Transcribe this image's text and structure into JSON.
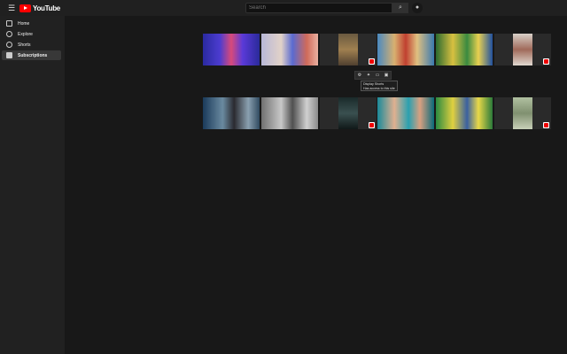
{
  "header": {
    "logo_text": "YouTube",
    "search_placeholder": "Search",
    "menu_icon": "hamburger-icon",
    "search_icon": "magnifier-icon",
    "mic_icon": "microphone-icon"
  },
  "sidebar": {
    "items": [
      {
        "label": "Home",
        "icon": "home-icon",
        "active": false
      },
      {
        "label": "Explore",
        "icon": "compass-icon",
        "active": false
      },
      {
        "label": "Shorts",
        "icon": "shorts-icon",
        "active": false
      },
      {
        "label": "Subscriptions",
        "icon": "subscriptions-icon",
        "active": true
      }
    ]
  },
  "extension": {
    "buttons": [
      "settings-icon",
      "puzzle-icon",
      "tv-icon",
      "window-icon"
    ],
    "tooltip_line1": "Display Shorts",
    "tooltip_line2": "Has access to this site"
  },
  "colors": {
    "background": "#181818",
    "topbar": "#202020",
    "sidebar": "#212121",
    "active_item": "#383838",
    "brand_red": "#ff0000"
  }
}
